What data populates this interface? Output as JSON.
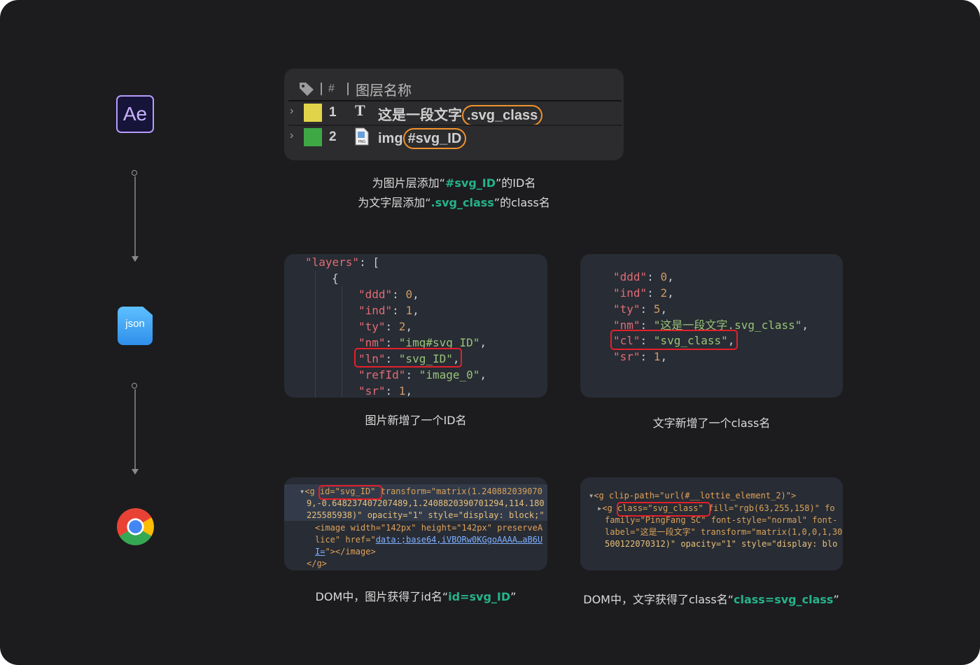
{
  "timeline": {
    "ae_icon": "Ae",
    "json_icon": "json",
    "chrome_icon": "chrome-icon"
  },
  "ae_panel": {
    "hash_header": "#",
    "column_header": "图层名称",
    "layers": [
      {
        "num": "1",
        "type_icon": "T",
        "name_base": "这是一段文字",
        "name_suffix": ".svg_class",
        "color": "#e2d44a"
      },
      {
        "num": "2",
        "type_icon": "PNG",
        "name_base": "img",
        "name_suffix": "#svg_ID",
        "color": "#3ea845"
      }
    ]
  },
  "caption_ae": {
    "line1_pre": "为图片层添加“",
    "line1_hl": "#svg_ID",
    "line1_post": "”的ID名",
    "line2_pre": "为文字层添加“",
    "line2_hl": ".svg_class",
    "line2_post": "”的class名"
  },
  "json_image": {
    "lines": [
      "\"layers\": [",
      "{",
      "\"ddd\": 0,",
      "\"ind\": 1,",
      "\"ty\": 2,",
      "\"nm\": \"img#svg_ID\",",
      "\"ln\": \"svg_ID\",",
      "\"refId\": \"image_0\",",
      "\"sr\": 1,"
    ],
    "caption": "图片新增了一个ID名"
  },
  "json_text": {
    "lines": [
      "\"ddd\": 0,",
      "\"ind\": 2,",
      "\"ty\": 5,",
      "\"nm\": \"这是一段文字.svg_class\",",
      "\"cl\": \"svg_class\",",
      "\"sr\": 1,"
    ],
    "caption": "文字新增了一个class名"
  },
  "dom_image": {
    "line1_tag": "<g ",
    "line1_id": "id=\"svg_ID\"",
    "line1_rest": " transform=\"matrix(1.240882039070",
    "line2": "9,-0.648237407207489,1.2408820390701294,114.180",
    "line3": "225585938)\" opacity=\"1\" style=\"display: block;\"",
    "line4": "<image width=\"142px\" height=\"142px\" preserveA",
    "line5_pre": "lice\" href=\"",
    "line5_link": "data:;base64,iVBORw0KGgoAAAA…aB6U",
    "line6_link": "I=",
    "line6_post": "\"></image>",
    "line7": "</g>",
    "caption_pre": "DOM中，图片获得了id名“",
    "caption_hl": "id=svg_ID",
    "caption_post": "”"
  },
  "dom_text": {
    "line1": "<g clip-path=\"url(#__lottie_element_2)\">",
    "line2_tag": "<g ",
    "line2_class": "class=\"svg_class\"",
    "line2_rest": " fill=\"rgb(63,255,158)\" fo",
    "line3": "family=\"PingFang SC\" font-style=\"normal\" font-",
    "line4": "label=\"这是一段文字\" transform=\"matrix(1,0,0,1,30",
    "line5": "500122070312)\" opacity=\"1\" style=\"display: blo",
    "caption_pre": "DOM中，文字获得了class名“",
    "caption_hl": "class=svg_class",
    "caption_post": "”"
  }
}
